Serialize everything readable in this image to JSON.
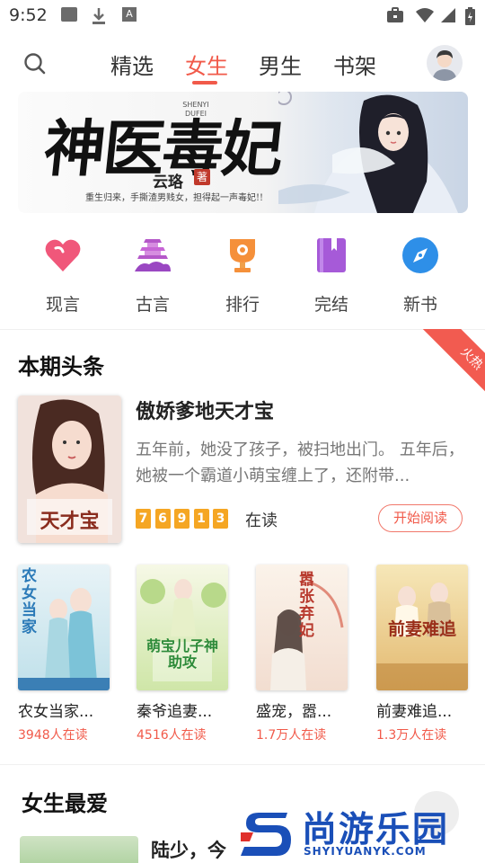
{
  "status_bar": {
    "time": "9:52",
    "left_icons": [
      "image-icon",
      "download-icon",
      "a-icon"
    ],
    "a_glyph": "A",
    "right_icons": [
      "bag-icon",
      "wifi-icon",
      "signal-icon",
      "battery-icon"
    ]
  },
  "header": {
    "search_icon": "search-icon",
    "tabs": [
      {
        "label": "精选",
        "active": false
      },
      {
        "label": "女生",
        "active": true
      },
      {
        "label": "男生",
        "active": false
      },
      {
        "label": "书架",
        "active": false
      }
    ],
    "avatar_icon": "user-avatar-icon",
    "accent_color": "#f15a4a"
  },
  "banner": {
    "title": "神医毒妃",
    "author": "云珞",
    "seal": "著",
    "subtitle": "SHENYI DUFEI",
    "tagline": "重生归来，手撕渣男贱女，担得起一声毒妃!!"
  },
  "categories": [
    {
      "label": "现言",
      "icon": "heart-icon",
      "color": "#f0577a"
    },
    {
      "label": "古言",
      "icon": "pagoda-icon",
      "color": "#b558c9"
    },
    {
      "label": "排行",
      "icon": "trophy-icon",
      "color": "#f5903a"
    },
    {
      "label": "完结",
      "icon": "book-icon",
      "color": "#a65ad8"
    },
    {
      "label": "新书",
      "icon": "compass-icon",
      "color": "#2e8fe8"
    }
  ],
  "headline_section": {
    "title": "本期头条",
    "ribbon": "火热",
    "featured": {
      "title": "傲娇爹地天才宝",
      "description": "五年前，她没了孩子，被扫地出门。 五年后，她被一个霸道小萌宝缠上了，还附带...",
      "reader_digits": [
        "7",
        "6",
        "9",
        "1",
        "3"
      ],
      "reader_suffix": "在读",
      "read_button": "开始阅读",
      "cover_text": "天才宝"
    },
    "books": [
      {
        "title": "农女当家...",
        "readers": "3948人在读",
        "cover_text": "农女当家"
      },
      {
        "title": "秦爷追妻...",
        "readers": "4516人在读",
        "cover_text": "萌宝儿子神助攻"
      },
      {
        "title": "盛宠，嚣...",
        "readers": "1.7万人在读",
        "cover_text": "嚣张弃妃"
      },
      {
        "title": "前妻难追...",
        "readers": "1.3万人在读",
        "cover_text": "前妻难追"
      }
    ]
  },
  "favorites_section": {
    "title": "女生最爱",
    "first_book_title": "陆少，今"
  },
  "watermark": {
    "text": "尚游乐园",
    "url": "SHYIYUANYK.COM"
  }
}
